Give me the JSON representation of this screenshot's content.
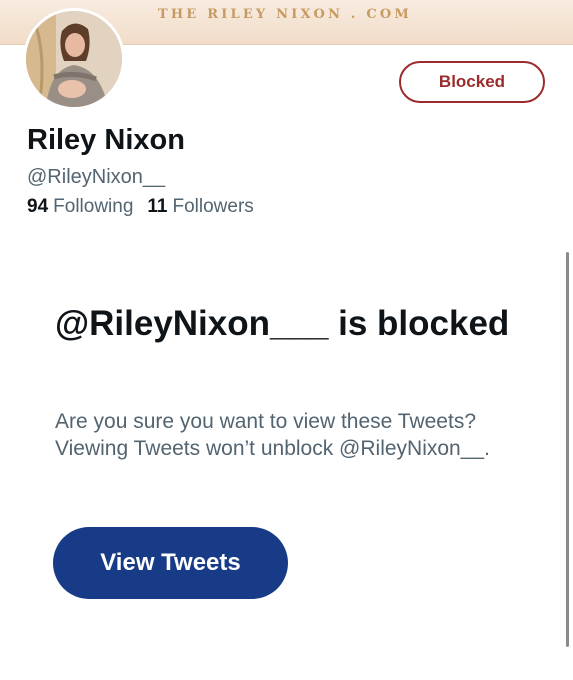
{
  "banner": {
    "text": "THE RILEY NIXON . COM"
  },
  "profile": {
    "display_name": "Riley Nixon",
    "handle": "@RileyNixon__",
    "following_count": "94",
    "following_label": "Following",
    "followers_count": "11",
    "followers_label": "Followers",
    "blocked_button_label": "Blocked"
  },
  "blocked_notice": {
    "heading": "@RileyNixon___ is blocked",
    "description": "Are you sure you want to view these Tweets? Viewing Tweets won’t unblock @RileyNixon__.",
    "view_button_label": "View Tweets"
  },
  "colors": {
    "accent_blocked": "#9b2c2c",
    "view_button_bg": "#173b86",
    "banner_text": "#c79a62"
  },
  "icons": {
    "avatar": "profile-photo"
  }
}
